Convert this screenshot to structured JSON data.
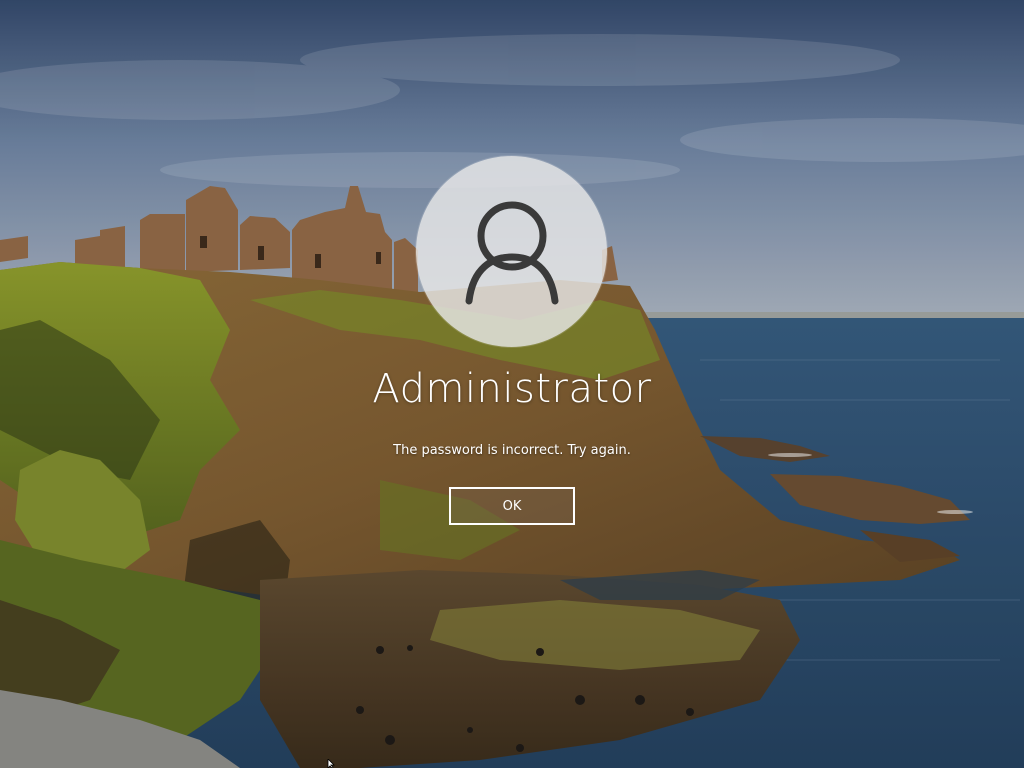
{
  "login": {
    "username": "Administrator",
    "error_message": "The password is incorrect. Try again.",
    "ok_label": "OK",
    "avatar_icon": "user-silhouette-icon"
  },
  "colors": {
    "text": "#ffffff",
    "sky_top": "#3e5478",
    "sea": "#2f4f70",
    "cliff": "#8a6a3a",
    "grass": "#7a8a2a"
  }
}
